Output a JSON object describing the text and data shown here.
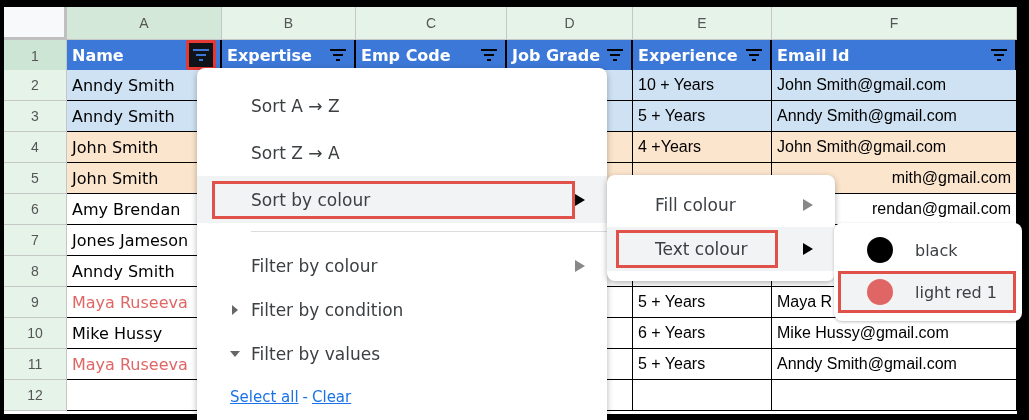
{
  "columns": [
    {
      "label": "A",
      "selected": true
    },
    {
      "label": "B",
      "selected": false
    },
    {
      "label": "C",
      "selected": false
    },
    {
      "label": "D",
      "selected": false
    },
    {
      "label": "E",
      "selected": false
    },
    {
      "label": "F",
      "selected": false
    }
  ],
  "header_row": {
    "number": "1",
    "cells": [
      {
        "label": "Name",
        "filter_active": true
      },
      {
        "label": "Expertise",
        "filter_active": false
      },
      {
        "label": "Emp Code",
        "filter_active": false
      },
      {
        "label": "Job Grade",
        "filter_active": false
      },
      {
        "label": "Experience",
        "filter_active": false
      },
      {
        "label": "Email Id",
        "filter_active": false
      }
    ]
  },
  "rows": [
    {
      "number": "2",
      "color": "#cfe2f3",
      "name": {
        "text": "Anndy Smith",
        "color": "#000000"
      },
      "experience": "10 + Years",
      "email": {
        "text": "John Smith@gmail.com",
        "clipped": false
      }
    },
    {
      "number": "3",
      "color": "#cfe2f3",
      "name": {
        "text": "Anndy Smith",
        "color": "#000000"
      },
      "experience": "5 + Years",
      "email": {
        "text": "Anndy Smith@gmail.com",
        "clipped": false
      }
    },
    {
      "number": "4",
      "color": "#fce5cd",
      "name": {
        "text": "John Smith",
        "color": "#000000"
      },
      "experience": "4 +Years",
      "email": {
        "text": "John Smith@gmail.com",
        "clipped": false
      }
    },
    {
      "number": "5",
      "color": "#fce5cd",
      "name": {
        "text": "John Smith",
        "color": "#000000"
      },
      "email": {
        "text": "mith@gmail.com",
        "clipped": true
      }
    },
    {
      "number": "6",
      "color": "#ffffff",
      "name": {
        "text": "Amy Brendan",
        "color": "#000000"
      },
      "email": {
        "text": "rendan@gmail.com",
        "clipped": true
      }
    },
    {
      "number": "7",
      "color": "#ffffff",
      "name": {
        "text": "Jones Jameson",
        "color": "#000000"
      }
    },
    {
      "number": "8",
      "color": "#ffffff",
      "name": {
        "text": "Anndy Smith",
        "color": "#000000"
      }
    },
    {
      "number": "9",
      "color": "#ffffff",
      "name": {
        "text": "Maya Ruseeva",
        "color": "#e06666"
      },
      "experience": "5 + Years",
      "email": {
        "text": "Maya R",
        "clipped": false
      }
    },
    {
      "number": "10",
      "color": "#ffffff",
      "name": {
        "text": "Mike Hussy",
        "color": "#000000"
      },
      "experience": "6 + Years",
      "email": {
        "text": "Mike Hussy@gmail.com",
        "clipped": false
      }
    },
    {
      "number": "11",
      "color": "#ffffff",
      "name": {
        "text": "Maya Ruseeva",
        "color": "#e06666"
      },
      "experience": "5 + Years",
      "email": {
        "text": "Anndy Smith@gmail.com",
        "clipped": false
      }
    },
    {
      "number": "12",
      "color": "#ffffff"
    }
  ],
  "filter_menu": {
    "groups": [
      [
        {
          "label": "Sort A → Z",
          "kind": "action",
          "selected": false
        },
        {
          "label": "Sort Z → A",
          "kind": "action",
          "selected": false
        },
        {
          "label": "Sort by colour",
          "kind": "submenu",
          "selected": true
        }
      ],
      [
        {
          "label": "Filter by colour",
          "kind": "submenu",
          "selected": false
        },
        {
          "label": "Filter by condition",
          "kind": "section",
          "expanded": false
        },
        {
          "label": "Filter by values",
          "kind": "section",
          "expanded": true
        }
      ]
    ],
    "footer": [
      {
        "text": "Select all",
        "kind": "link"
      },
      {
        "text": "-",
        "kind": "separator"
      },
      {
        "text": "Clear",
        "kind": "link"
      }
    ]
  },
  "sort_colour_menu": {
    "items": [
      {
        "label": "Fill colour",
        "selected": false
      },
      {
        "label": "Text colour",
        "selected": true
      }
    ]
  },
  "text_colour_menu": {
    "items": [
      {
        "label": "black",
        "color": "#000000",
        "selected": false
      },
      {
        "label": "light red 1",
        "color": "#e06666",
        "selected": true
      }
    ]
  }
}
